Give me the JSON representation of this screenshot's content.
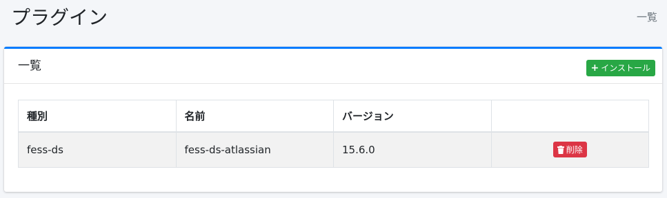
{
  "header": {
    "title": "プラグイン",
    "breadcrumb": "一覧"
  },
  "card": {
    "title": "一覧",
    "install_label": "インストール",
    "accent_color": "#007bff"
  },
  "table": {
    "columns": [
      "種別",
      "名前",
      "バージョン",
      ""
    ],
    "rows": [
      {
        "type": "fess-ds",
        "name": "fess-ds-atlassian",
        "version": "15.6.0",
        "delete_label": "削除"
      }
    ]
  },
  "colors": {
    "install": "#28a745",
    "delete": "#dc3545"
  }
}
